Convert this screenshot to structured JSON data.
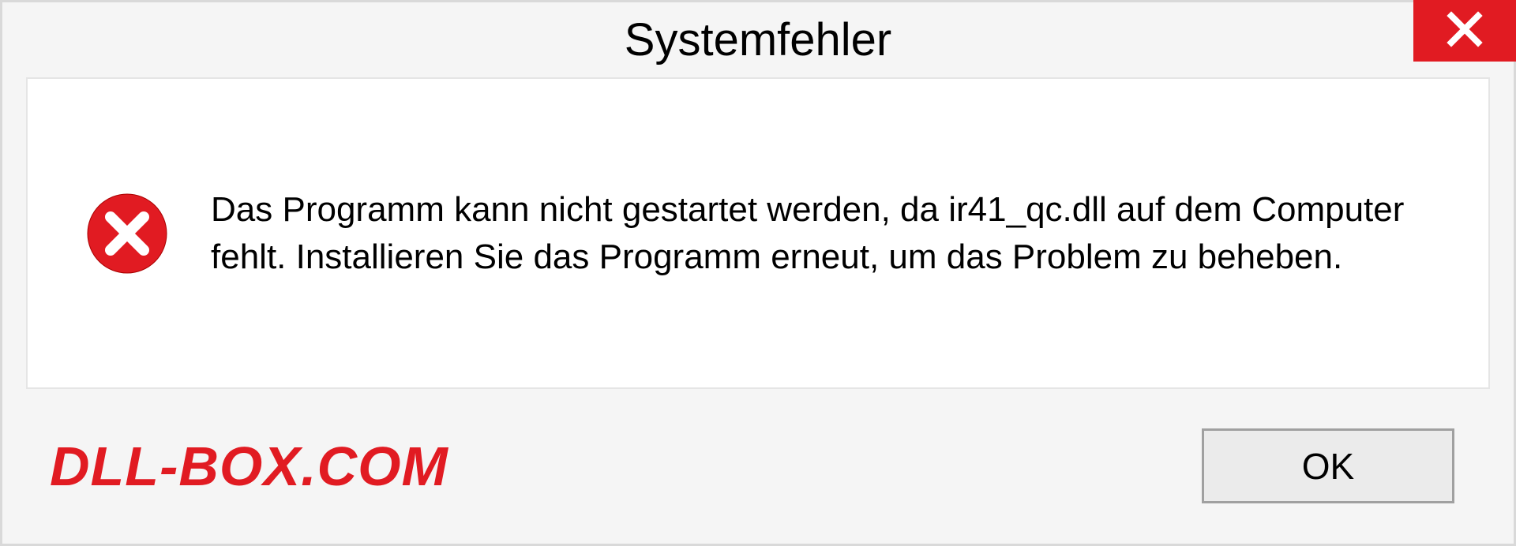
{
  "dialog": {
    "title": "Systemfehler",
    "message": "Das Programm kann nicht gestartet werden, da ir41_qc.dll auf dem Computer fehlt. Installieren Sie das Programm erneut, um das Problem zu beheben.",
    "ok_label": "OK"
  },
  "watermark": "DLL-BOX.COM"
}
